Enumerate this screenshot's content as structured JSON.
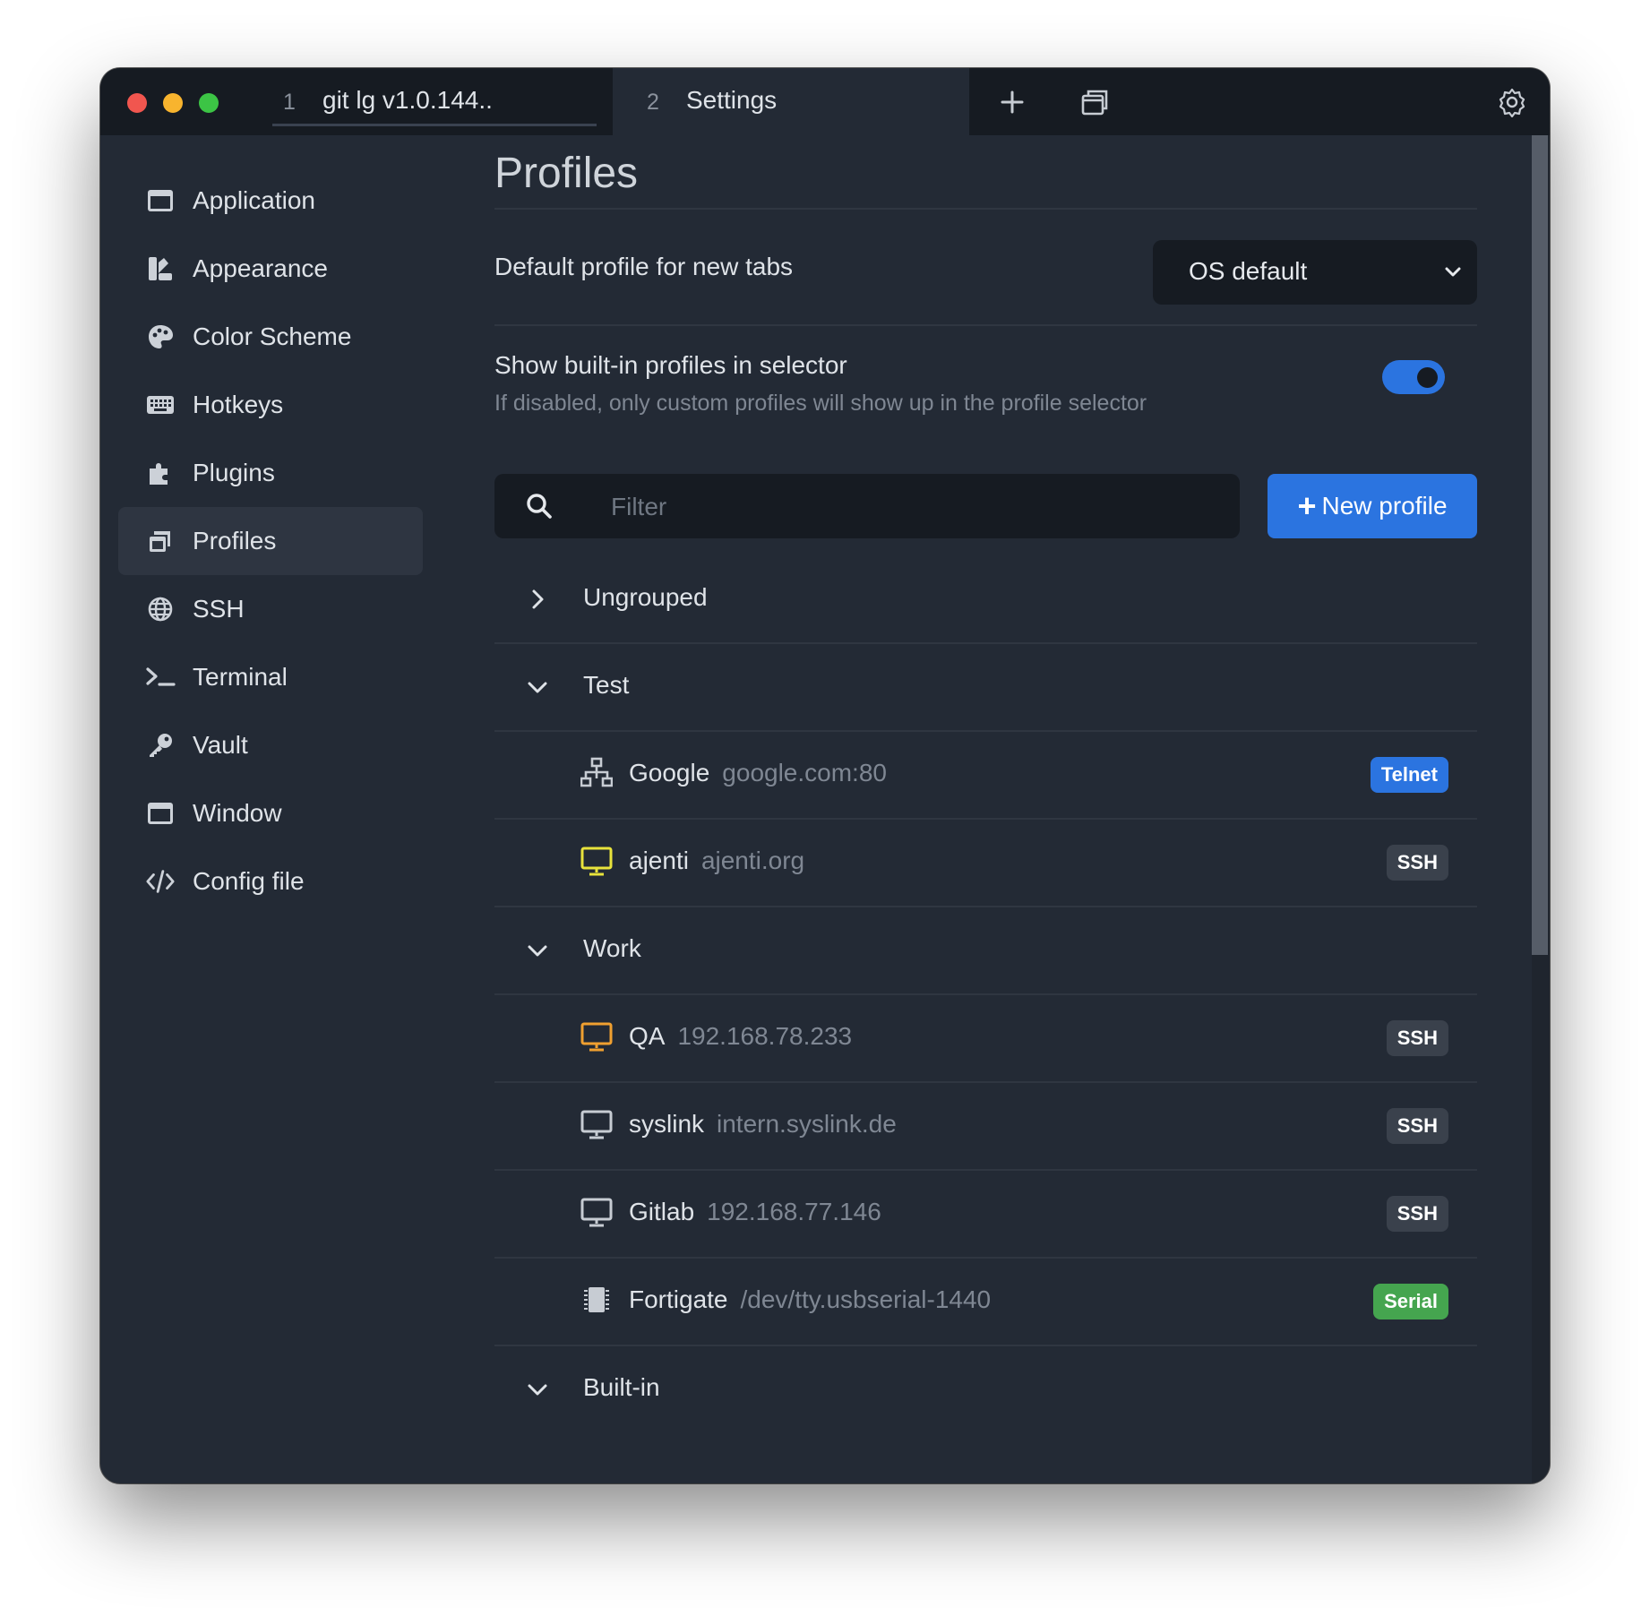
{
  "tabs": [
    {
      "number": "1",
      "title": "git lg v1.0.144.."
    },
    {
      "number": "2",
      "title": "Settings"
    }
  ],
  "sidebar": {
    "items": [
      {
        "label": "Application",
        "icon": "window-icon"
      },
      {
        "label": "Appearance",
        "icon": "paint-brush-icon"
      },
      {
        "label": "Color Scheme",
        "icon": "palette-icon"
      },
      {
        "label": "Hotkeys",
        "icon": "keyboard-icon"
      },
      {
        "label": "Plugins",
        "icon": "puzzle-icon"
      },
      {
        "label": "Profiles",
        "icon": "profiles-icon",
        "active": true
      },
      {
        "label": "SSH",
        "icon": "globe-icon"
      },
      {
        "label": "Terminal",
        "icon": "terminal-icon"
      },
      {
        "label": "Vault",
        "icon": "key-icon"
      },
      {
        "label": "Window",
        "icon": "window-icon"
      },
      {
        "label": "Config file",
        "icon": "code-icon"
      }
    ]
  },
  "main": {
    "title": "Profiles",
    "default_profile": {
      "label": "Default profile for new tabs",
      "value": "OS default"
    },
    "builtin_toggle": {
      "title": "Show built-in profiles in selector",
      "description": "If disabled, only custom profiles will show up in the profile selector",
      "enabled": true
    },
    "filter": {
      "placeholder": "Filter"
    },
    "new_profile_label": "New profile"
  },
  "groups": [
    {
      "name": "Ungrouped",
      "expanded": false,
      "profiles": []
    },
    {
      "name": "Test",
      "expanded": true,
      "profiles": [
        {
          "name": "Google",
          "host": "google.com:80",
          "badge": "Telnet",
          "badge_color": "#2b74e0",
          "icon": "network-icon",
          "icon_color": "#c7ccd3"
        },
        {
          "name": "ajenti",
          "host": "ajenti.org",
          "badge": "SSH",
          "badge_color": "#3a414c",
          "icon": "monitor-icon",
          "icon_color": "#e8e33c"
        }
      ]
    },
    {
      "name": "Work",
      "expanded": true,
      "profiles": [
        {
          "name": "QA",
          "host": "192.168.78.233",
          "badge": "SSH",
          "badge_color": "#3a414c",
          "icon": "monitor-icon",
          "icon_color": "#f0a030"
        },
        {
          "name": "syslink",
          "host": "intern.syslink.de",
          "badge": "SSH",
          "badge_color": "#3a414c",
          "icon": "monitor-icon",
          "icon_color": "#c7ccd3"
        },
        {
          "name": "Gitlab",
          "host": "192.168.77.146",
          "badge": "SSH",
          "badge_color": "#3a414c",
          "icon": "monitor-icon",
          "icon_color": "#c7ccd3"
        },
        {
          "name": "Fortigate",
          "host": "/dev/tty.usbserial-1440",
          "badge": "Serial",
          "badge_color": "#45a54f",
          "icon": "chip-icon",
          "icon_color": "#c7ccd3"
        }
      ]
    },
    {
      "name": "Built-in",
      "expanded": true,
      "profiles": []
    }
  ]
}
